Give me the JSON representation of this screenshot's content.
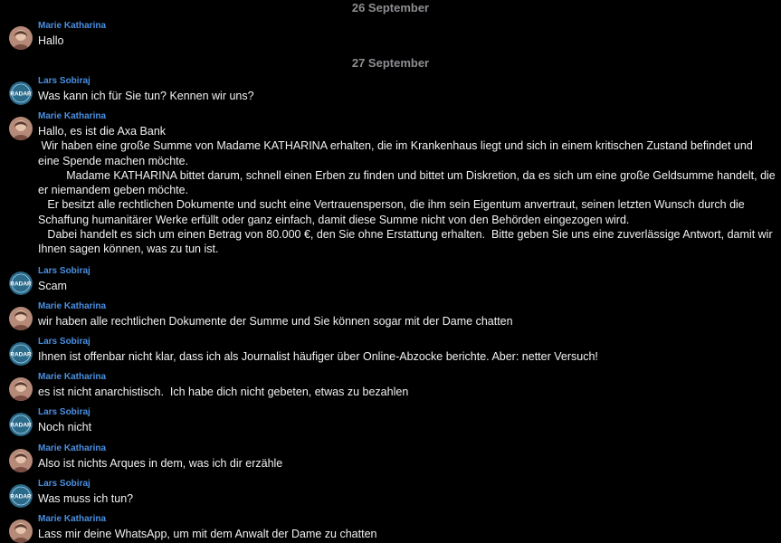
{
  "dates": [
    "26 September",
    "27 September"
  ],
  "participants": {
    "marie": "Marie Katharina",
    "lars": "Lars Sobiraj"
  },
  "messages": [
    {
      "sender": "Marie Katharina",
      "avatar": "photo-avatar",
      "text": "Hallo"
    },
    {
      "sender": "Lars Sobiraj",
      "avatar": "radar-logo-avatar",
      "avatar_text": "RADAR",
      "text": "Was kann ich für Sie tun? Kennen wir uns?"
    },
    {
      "sender": "Marie Katharina",
      "avatar": "photo-avatar",
      "text": "Hallo, es ist die Axa Bank\n Wir haben eine große Summe von Madame KATHARINA erhalten, die im Krankenhaus liegt und sich in einem kritischen Zustand befindet und eine Spende machen möchte.\n         Madame KATHARINA bittet darum, schnell einen Erben zu finden und bittet um Diskretion, da es sich um eine große Geldsumme handelt, die er niemandem geben möchte.\n   Er besitzt alle rechtlichen Dokumente und sucht eine Vertrauensperson, die ihm sein Eigentum anvertraut, seinen letzten Wunsch durch die Schaffung humanitärer Werke erfüllt oder ganz einfach, damit diese Summe nicht von den Behörden eingezogen wird.\n   Dabei handelt es sich um einen Betrag von 80.000 €, den Sie ohne Erstattung erhalten.  Bitte geben Sie uns eine zuverlässige Antwort, damit wir Ihnen sagen können, was zu tun ist."
    },
    {
      "sender": "Lars Sobiraj",
      "avatar": "radar-logo-avatar",
      "avatar_text": "RADAR",
      "text": "Scam"
    },
    {
      "sender": "Marie Katharina",
      "avatar": "photo-avatar",
      "text": "wir haben alle rechtlichen Dokumente der Summe und Sie können sogar mit der Dame chatten"
    },
    {
      "sender": "Lars Sobiraj",
      "avatar": "radar-logo-avatar",
      "avatar_text": "RADAR",
      "text": "Ihnen ist offenbar nicht klar, dass ich als Journalist häufiger über Online-Abzocke berichte. Aber: netter Versuch!"
    },
    {
      "sender": "Marie Katharina",
      "avatar": "photo-avatar",
      "text": "es ist nicht anarchistisch.  Ich habe dich nicht gebeten, etwas zu bezahlen"
    },
    {
      "sender": "Lars Sobiraj",
      "avatar": "radar-logo-avatar",
      "avatar_text": "RADAR",
      "text": "Noch nicht"
    },
    {
      "sender": "Marie Katharina",
      "avatar": "photo-avatar",
      "text": "Also ist nichts Arques in dem, was ich dir erzähle"
    },
    {
      "sender": "Lars Sobiraj",
      "avatar": "radar-logo-avatar",
      "avatar_text": "RADAR",
      "text": "Was muss ich tun?"
    },
    {
      "sender": "Marie Katharina",
      "avatar": "photo-avatar",
      "text": "Lass mir deine WhatsApp, um mit dem Anwalt der Dame zu chatten"
    }
  ],
  "colors": {
    "background": "#000000",
    "sender_name": "#4a90e2",
    "message_text": "#f2f2f2",
    "date_separator": "#8e8e93",
    "radar_logo_bg": "#2c6a8a"
  }
}
